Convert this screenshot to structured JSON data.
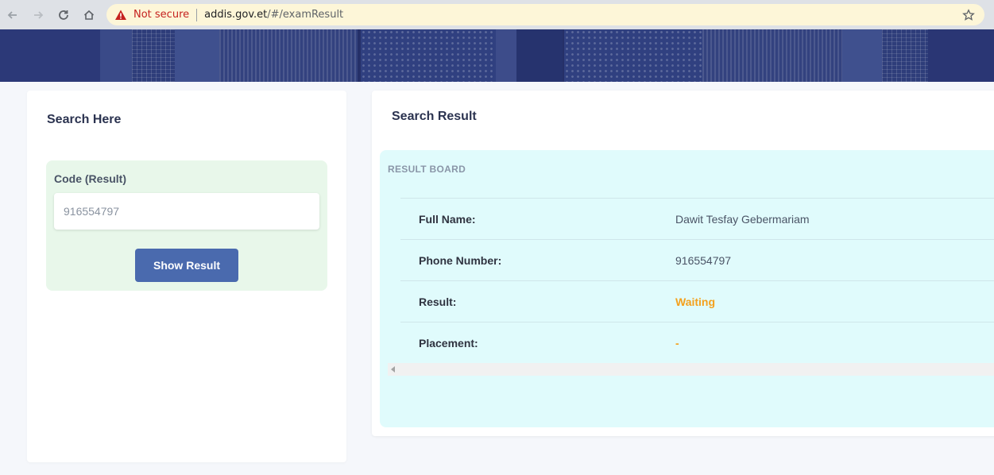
{
  "browser": {
    "security_label": "Not secure",
    "url_host": "addis.gov.et",
    "url_path": "/#/examResult",
    "icons": [
      "back-icon",
      "forward-icon",
      "reload-icon",
      "home-icon",
      "warning-icon",
      "star-icon"
    ]
  },
  "search_panel": {
    "title": "Search Here",
    "code_label": "Code (Result)",
    "code_value": "916554797",
    "button_label": "Show Result"
  },
  "result_panel": {
    "title": "Search Result",
    "board_label": "RESULT BOARD",
    "rows": [
      {
        "key": "Full Name:",
        "value": "Dawit Tesfay Gebermariam"
      },
      {
        "key": "Phone Number:",
        "value": "916554797"
      },
      {
        "key": "Result:",
        "value": "Waiting"
      },
      {
        "key": "Placement:",
        "value": "-"
      }
    ]
  },
  "colors": {
    "button": "#4a6aae",
    "search_box_bg": "#e8f7ea",
    "result_board_bg": "#e0fbfc",
    "status_orange": "#f4a01c",
    "banner": "#253068"
  }
}
